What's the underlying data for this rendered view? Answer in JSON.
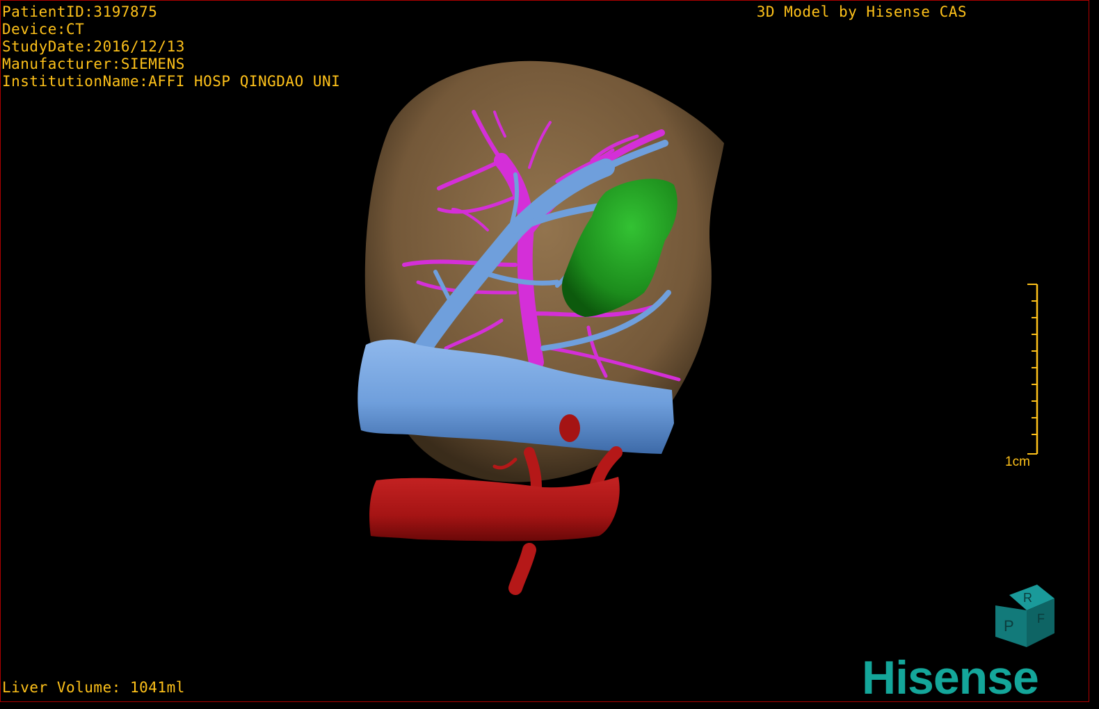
{
  "header": {
    "patient_id": "PatientID:3197875",
    "device": "Device:CT",
    "study_date": "StudyDate:2016/12/13",
    "manufacturer": "Manufacturer:SIEMENS",
    "institution": "InstitutionName:AFFI HOSP QINGDAO UNI"
  },
  "credit": "3D Model by Hisense CAS",
  "footer": {
    "liver_volume": "Liver Volume: 1041ml"
  },
  "scale": {
    "label": "1cm"
  },
  "orientation_cube": {
    "faces": [
      "R",
      "F",
      "P"
    ],
    "color": "#127a7a"
  },
  "brand": {
    "logo_text": "Hisense",
    "color": "#14a69a"
  },
  "colors": {
    "text": "#ffc21a",
    "liver": "#8a6a45",
    "portal_vein": "#6f9fdc",
    "hepatic_vein": "#d42fd8",
    "tumor": "#1f9a1f",
    "artery": "#b51818",
    "border": "#b00000"
  }
}
